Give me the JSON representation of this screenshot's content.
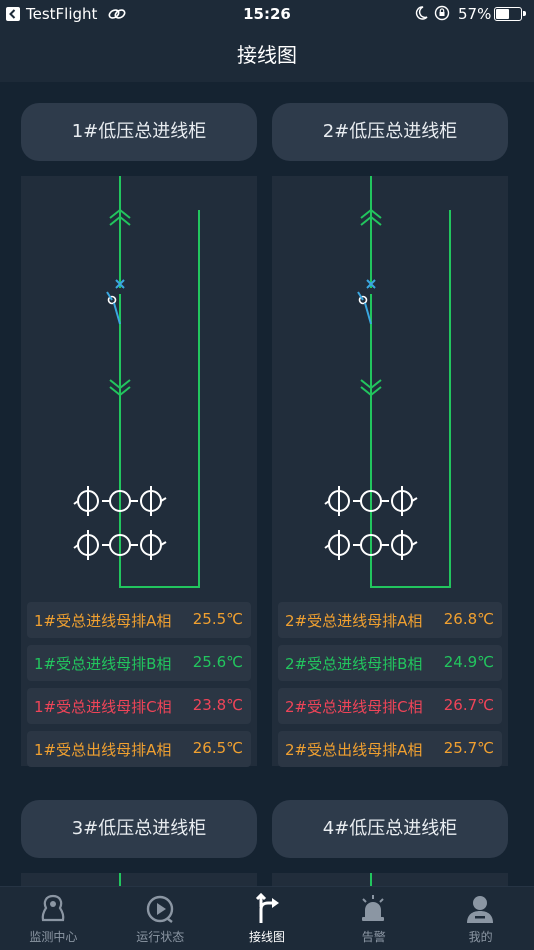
{
  "status_bar": {
    "carrier": "TestFlight",
    "time": "15:26",
    "battery": "57%",
    "battery_level": 0.57
  },
  "nav": {
    "title": "接线图"
  },
  "cabinets": [
    {
      "title": "1#低压总进线柜",
      "readings": [
        {
          "label": "1#受总进线母排A相",
          "value": "25.5℃",
          "color": "#f0a030"
        },
        {
          "label": "1#受总进线母排B相",
          "value": "25.6℃",
          "color": "#22c55e"
        },
        {
          "label": "1#受总进线母排C相",
          "value": "23.8℃",
          "color": "#ef4458"
        },
        {
          "label": "1#受总出线母排A相",
          "value": "26.5℃",
          "color": "#f0a030"
        }
      ]
    },
    {
      "title": "2#低压总进线柜",
      "readings": [
        {
          "label": "2#受总进线母排A相",
          "value": "26.8℃",
          "color": "#f0a030"
        },
        {
          "label": "2#受总进线母排B相",
          "value": "24.9℃",
          "color": "#22c55e"
        },
        {
          "label": "2#受总进线母排C相",
          "value": "26.7℃",
          "color": "#ef4458"
        },
        {
          "label": "2#受总出线母排A相",
          "value": "25.7℃",
          "color": "#f0a030"
        }
      ]
    },
    {
      "title": "3#低压总进线柜"
    },
    {
      "title": "4#低压总进线柜"
    }
  ],
  "tabs": [
    {
      "label": "监测中心",
      "icon": "monitor-center-icon"
    },
    {
      "label": "运行状态",
      "icon": "run-status-icon"
    },
    {
      "label": "接线图",
      "icon": "wiring-diagram-icon",
      "active": true
    },
    {
      "label": "告警",
      "icon": "alarm-icon"
    },
    {
      "label": "我的",
      "icon": "profile-icon"
    }
  ],
  "colors": {
    "line_green": "#22c55e",
    "switch_blue": "#3aa7e0",
    "background": "#152331",
    "panel": "#212d3b"
  }
}
